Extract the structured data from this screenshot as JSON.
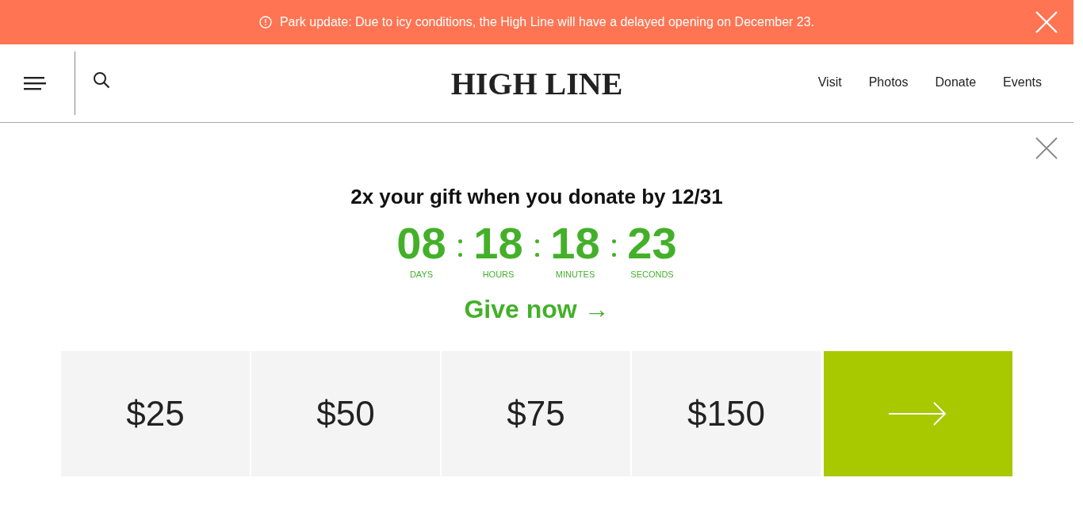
{
  "alert": {
    "text": "Park update: Due to icy conditions, the High Line will have a delayed opening on December 23."
  },
  "header": {
    "logo": "HIGH LINE",
    "nav": [
      "Visit",
      "Photos",
      "Donate",
      "Events"
    ]
  },
  "promo": {
    "heading": "2x your gift when you donate by 12/31",
    "countdown": [
      {
        "value": "08",
        "label": "DAYS"
      },
      {
        "value": "18",
        "label": "HOURS"
      },
      {
        "value": "18",
        "label": "MINUTES"
      },
      {
        "value": "23",
        "label": "SECONDS"
      }
    ],
    "cta": "Give now →",
    "amounts": [
      "$25",
      "$50",
      "$75",
      "$150"
    ]
  }
}
